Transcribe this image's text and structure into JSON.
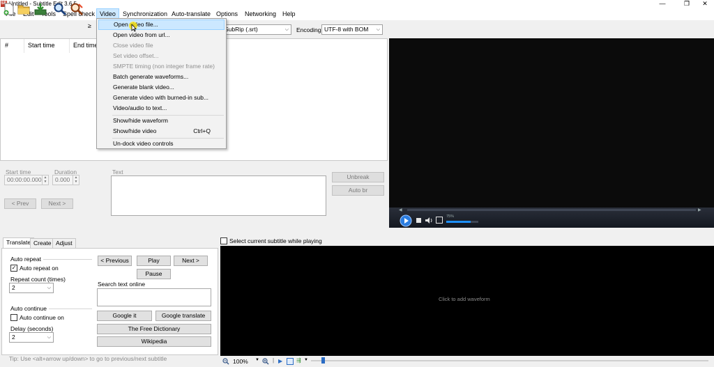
{
  "window": {
    "title": "Untitled - Subtitle Edit 3.6.5",
    "icon_text": "SE",
    "minimize": "—",
    "restore": "❐",
    "close": "✕"
  },
  "menu": {
    "file": "File",
    "edit": "Edit",
    "tools": "Tools",
    "spell_check": "Spell check",
    "video": "Video",
    "synchronization": "Synchronization",
    "auto_translate": "Auto-translate",
    "options": "Options",
    "networking": "Networking",
    "help": "Help"
  },
  "toolbar": {
    "format_value": "SubRip (.srt)",
    "encoding_label": "Encoding",
    "encoding_value": "UTF-8 with BOM"
  },
  "video_menu": {
    "items": [
      {
        "label": "Open video file...",
        "disabled": false,
        "hover": true
      },
      {
        "label": "Open video from url...",
        "disabled": false
      },
      {
        "label": "Close video file",
        "disabled": true
      },
      {
        "label": "Set video offset...",
        "disabled": true
      },
      {
        "label": "SMPTE timing (non integer frame rate)",
        "disabled": true
      },
      {
        "label": "Batch generate waveforms...",
        "disabled": false
      },
      {
        "label": "Generate blank video...",
        "disabled": false
      },
      {
        "label": "Generate video with burned-in sub...",
        "disabled": false
      },
      {
        "label": "Video/audio to text...",
        "disabled": false
      },
      {
        "label": "Show/hide waveform",
        "disabled": false
      },
      {
        "label": "Show/hide video",
        "disabled": false,
        "shortcut": "Ctrl+Q"
      },
      {
        "label": "Un-dock video controls",
        "disabled": false
      }
    ]
  },
  "subtitle_list": {
    "columns": [
      "#",
      "Start time",
      "End time"
    ]
  },
  "edit": {
    "start_time_label": "Start time",
    "start_time_value": "00:00:00.000",
    "duration_label": "Duration",
    "duration_value": "0.000",
    "text_label": "Text",
    "prev": "< Prev",
    "next": "Next >",
    "unbreak": "Unbreak",
    "auto_br": "Auto br"
  },
  "player": {
    "volume_readout": "75%"
  },
  "tabs": [
    "Translate",
    "Create",
    "Adjust"
  ],
  "translate": {
    "auto_repeat_group": "Auto repeat",
    "auto_repeat_on": "Auto repeat on",
    "repeat_count_label": "Repeat count (times)",
    "repeat_count_value": "2",
    "auto_continue_group": "Auto continue",
    "auto_continue_on": "Auto continue on",
    "delay_label": "Delay (seconds)",
    "delay_value": "2",
    "previous": "< Previous",
    "play": "Play",
    "next": "Next >",
    "pause": "Pause",
    "search_label": "Search text online",
    "google_it": "Google it",
    "google_translate": "Google translate",
    "free_dictionary": "The Free Dictionary",
    "wikipedia": "Wikipedia",
    "tip": "Tip: Use <alt+arrow up/down> to go to previous/next subtitle"
  },
  "waveform": {
    "select_while_playing": "Select current subtitle while playing",
    "placeholder": "Click to add waveform",
    "zoom": "100%"
  },
  "colors": {
    "menu_hover": "#cce8ff",
    "player_bg": "#0b0b0b",
    "waveform_bg": "#000000",
    "seek_accent": "#1e90ff"
  }
}
